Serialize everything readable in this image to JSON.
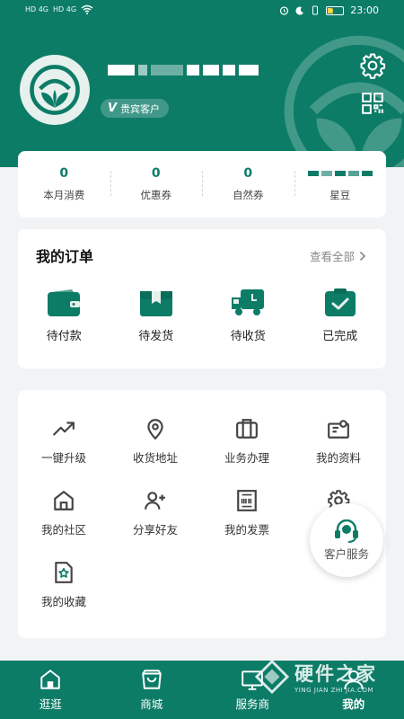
{
  "status_bar": {
    "left_indicators": [
      "HD 4G",
      "HD 4G"
    ],
    "time": "23:00",
    "battery": "12"
  },
  "profile": {
    "vip_mark": "V",
    "vip_label": "贵宾客户"
  },
  "stats": [
    {
      "value": "0",
      "label": "本月消费"
    },
    {
      "value": "0",
      "label": "优惠券"
    },
    {
      "value": "0",
      "label": "自然券"
    },
    {
      "value": "",
      "label": "星豆"
    }
  ],
  "orders": {
    "title": "我的订单",
    "view_all": "查看全部",
    "items": [
      {
        "icon": "wallet-icon",
        "label": "待付款"
      },
      {
        "icon": "box-icon",
        "label": "待发货"
      },
      {
        "icon": "truck-icon",
        "label": "待收货"
      },
      {
        "icon": "clipboard-check-icon",
        "label": "已完成"
      }
    ]
  },
  "services": [
    {
      "icon": "trend-up-icon",
      "label": "一键升级"
    },
    {
      "icon": "location-pin-icon",
      "label": "收货地址"
    },
    {
      "icon": "briefcase-icon",
      "label": "业务办理"
    },
    {
      "icon": "id-card-icon",
      "label": "我的资料"
    },
    {
      "icon": "home-icon",
      "label": "我的社区"
    },
    {
      "icon": "user-add-icon",
      "label": "分享好友"
    },
    {
      "icon": "invoice-icon",
      "label": "我的发票"
    },
    {
      "icon": "gear-icon",
      "label": ""
    },
    {
      "icon": "star-doc-icon",
      "label": "我的收藏"
    }
  ],
  "customer_service": {
    "label": "客户服务",
    "icon": "headset-icon"
  },
  "tabbar": [
    {
      "icon": "home-icon",
      "label": "逛逛"
    },
    {
      "icon": "shopping-bag-icon",
      "label": "商城"
    },
    {
      "icon": "store-icon",
      "label": "服务商"
    },
    {
      "icon": "user-icon",
      "label": "我的"
    }
  ],
  "watermark": {
    "name": "硬件之家",
    "sub": "YING JIAN ZHI JIA.COM"
  },
  "colors": {
    "brand": "#0c7c67",
    "background": "#f2f3f5"
  }
}
